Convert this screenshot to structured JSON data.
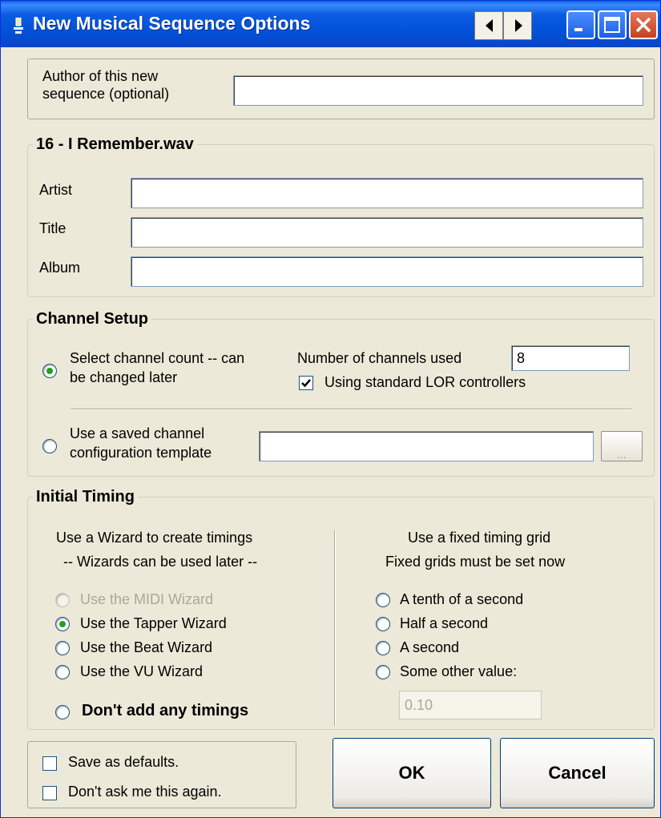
{
  "window": {
    "title": "New Musical Sequence Options"
  },
  "author": {
    "label_line1": "Author of this new",
    "label_line2": "sequence (optional)",
    "value": ""
  },
  "file_group": {
    "legend": "16 - I Remember.wav",
    "artist_label": "Artist",
    "artist_value": "",
    "title_label": "Title",
    "title_value": "",
    "album_label": "Album",
    "album_value": ""
  },
  "channel_setup": {
    "legend": "Channel Setup",
    "select_count_line1": "Select channel count -- can",
    "select_count_line2": "be changed later",
    "num_channels_label": "Number of channels used",
    "num_channels_value": "8",
    "standard_lor_label": "Using standard LOR controllers",
    "standard_lor_checked": true,
    "template_line1": "Use a saved channel",
    "template_line2": "configuration template",
    "template_value": "",
    "browse_label": "...",
    "selected_option": "select_count"
  },
  "initial_timing": {
    "legend": "Initial Timing",
    "wizard_heading_line1": "Use a Wizard to create timings",
    "wizard_heading_line2": "-- Wizards can be used later --",
    "midi_wizard": "Use the MIDI Wizard",
    "tapper_wizard": "Use the Tapper Wizard",
    "beat_wizard": "Use the Beat Wizard",
    "vu_wizard": "Use the VU Wizard",
    "no_timings": "Don't add any timings",
    "grid_heading_line1": "Use a fixed timing grid",
    "grid_heading_line2": "Fixed grids must be set now",
    "tenth_second": "A tenth of a second",
    "half_second": "Half a second",
    "a_second": "A second",
    "other_value": "Some other value:",
    "other_value_input": "0.10",
    "selected_option": "tapper_wizard"
  },
  "footer": {
    "save_defaults": "Save as defaults.",
    "dont_ask": "Don't ask me this again.",
    "ok_label": "OK",
    "cancel_label": "Cancel"
  },
  "colors": {
    "titlebar": "#0054e3",
    "dialog_bg": "#ece9d8",
    "radio_dot": "#21a121"
  }
}
